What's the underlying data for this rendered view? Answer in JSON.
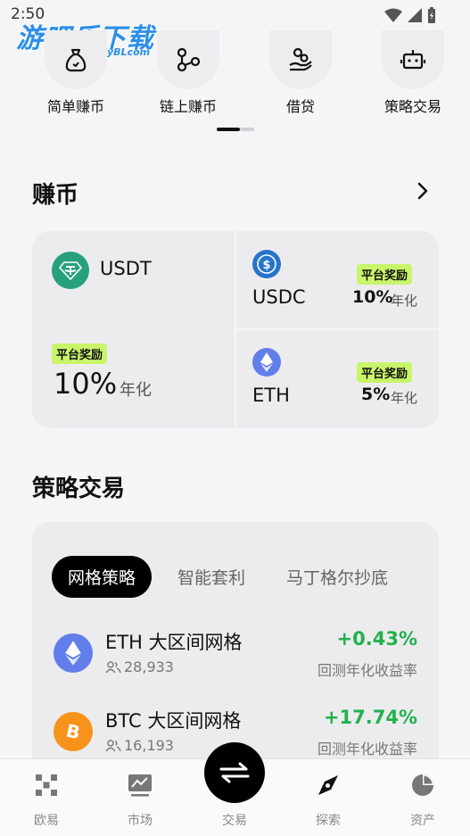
{
  "status": {
    "time": "2:50"
  },
  "watermark": {
    "main": "游吧乐下载",
    "sub": "yBLcom"
  },
  "quick_actions": [
    {
      "label": "简单赚币",
      "icon": "money-bag-icon"
    },
    {
      "label": "链上赚币",
      "icon": "chain-nodes-icon"
    },
    {
      "label": "借贷",
      "icon": "loan-hand-icon"
    },
    {
      "label": "策略交易",
      "icon": "robot-icon"
    }
  ],
  "earn": {
    "title": "赚币",
    "main": {
      "coin": "USDT",
      "badge": "平台奖励",
      "rate": "10%",
      "unit": "年化"
    },
    "side": [
      {
        "coin": "USDC",
        "badge": "平台奖励",
        "rate": "10%",
        "unit": "年化"
      },
      {
        "coin": "ETH",
        "badge": "平台奖励",
        "rate": "5%",
        "unit": "年化"
      }
    ]
  },
  "strategy": {
    "title": "策略交易",
    "tabs": [
      "网格策略",
      "智能套利",
      "马丁格尔抄底"
    ],
    "active_tab": 0,
    "rows": [
      {
        "name": "ETH 大区间网格",
        "users": "28,933",
        "return": "+0.43%",
        "return_label": "回测年化收益率"
      },
      {
        "name": "BTC 大区间网格",
        "users": "16,193",
        "return": "+17.74%",
        "return_label": "回测年化收益率"
      }
    ]
  },
  "nav": [
    {
      "label": "欧易",
      "icon": "okx-logo-icon"
    },
    {
      "label": "市场",
      "icon": "market-chart-icon"
    },
    {
      "label": "交易",
      "icon": "swap-arrows-icon"
    },
    {
      "label": "探索",
      "icon": "compass-icon"
    },
    {
      "label": "资产",
      "icon": "pie-chart-icon"
    }
  ],
  "colors": {
    "accent_green": "#22b14c",
    "badge_lime": "#c8f569",
    "usdt": "#26a17b",
    "usdc": "#2775ca",
    "eth": "#627eea",
    "btc": "#f7931a"
  }
}
